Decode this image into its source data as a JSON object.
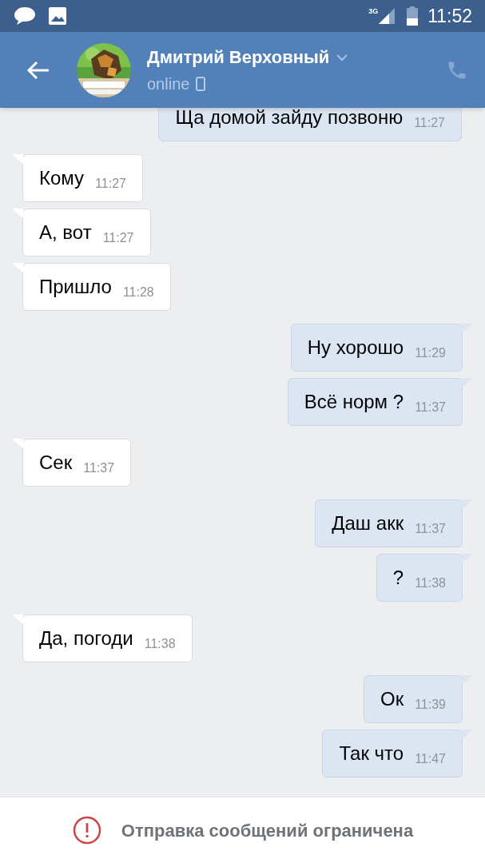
{
  "status_bar": {
    "network": "3G",
    "time": "11:52"
  },
  "header": {
    "name": "Дмитрий Верховный",
    "status": "online"
  },
  "messages": [
    {
      "kind": "outgoing",
      "text": "Ща домой зайду позвоню",
      "time": "11:27"
    },
    {
      "kind": "incoming",
      "text": "Кому",
      "time": "11:27"
    },
    {
      "kind": "incoming",
      "text": "А, вот",
      "time": "11:27"
    },
    {
      "kind": "incoming",
      "text": "Пришло",
      "time": "11:28"
    },
    {
      "kind": "outgoing",
      "text": "Ну хорошо",
      "time": "11:29"
    },
    {
      "kind": "outgoing",
      "text": "Всё норм ?",
      "time": "11:37"
    },
    {
      "kind": "incoming",
      "text": "Сек",
      "time": "11:37"
    },
    {
      "kind": "outgoing",
      "text": "Даш акк",
      "time": "11:37"
    },
    {
      "kind": "outgoing",
      "text": "?",
      "time": "11:38"
    },
    {
      "kind": "incoming",
      "text": "Да, погоди",
      "time": "11:38"
    },
    {
      "kind": "outgoing",
      "text": "Ок",
      "time": "11:39"
    },
    {
      "kind": "outgoing",
      "text": "Так что",
      "time": "11:47"
    }
  ],
  "notice": "Отправка сообщений ограничена"
}
